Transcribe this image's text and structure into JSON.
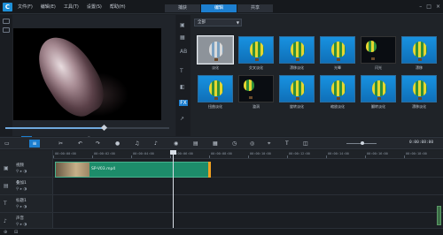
{
  "app": {
    "logo": "C",
    "menu": [
      "文件(F)",
      "编辑(E)",
      "工具(T)",
      "设置(S)",
      "帮助(H)"
    ],
    "tabs": [
      "捕获",
      "编辑",
      "共享"
    ],
    "active_tab": "编辑",
    "window_controls": [
      "–",
      "□",
      "×"
    ]
  },
  "player": {
    "progress": 0.6,
    "timecode": "00:00:00:00",
    "buttons": [
      "■",
      "▶",
      "⏮",
      "◀",
      "▶",
      "⏭",
      "↻",
      "🔊",
      "⛶"
    ]
  },
  "library": {
    "dropdown_value": "全部",
    "items": [
      {
        "label": "淡化",
        "style": "gray",
        "selected": true
      },
      {
        "label": "交叉淡化",
        "style": "blue"
      },
      {
        "label": "漂移淡化",
        "style": "blue"
      },
      {
        "label": "光晕",
        "style": "blue"
      },
      {
        "label": "闪光",
        "style": "dark"
      },
      {
        "label": "漂移",
        "style": "blue"
      },
      {
        "label": "扭曲淡化",
        "style": "blue"
      },
      {
        "label": "漩涡",
        "style": "dark"
      },
      {
        "label": "旋转淡化",
        "style": "blue"
      },
      {
        "label": "缩放淡化",
        "style": "blue"
      },
      {
        "label": "翻转淡化",
        "style": "blue"
      },
      {
        "label": "漂移淡化",
        "style": "blue"
      }
    ]
  },
  "toolbar": {
    "timecode": "0:00:08:00"
  },
  "timeline": {
    "ruler_ticks": [
      "00:00:00:00",
      "00:00:02:00",
      "00:00:04:00",
      "00:00:06:00",
      "00:00:08:00",
      "00:00:10:00",
      "00:00:12:00",
      "00:00:14:00",
      "00:00:16:00",
      "00:00:18:00"
    ],
    "tracks": [
      {
        "label": "视频",
        "icon": "▣"
      },
      {
        "label": "叠加1",
        "icon": "▤"
      },
      {
        "label": "标题1",
        "icon": "T"
      },
      {
        "label": "声音",
        "icon": "♪"
      }
    ],
    "clip": {
      "name": "SP-V03.mp4"
    }
  }
}
